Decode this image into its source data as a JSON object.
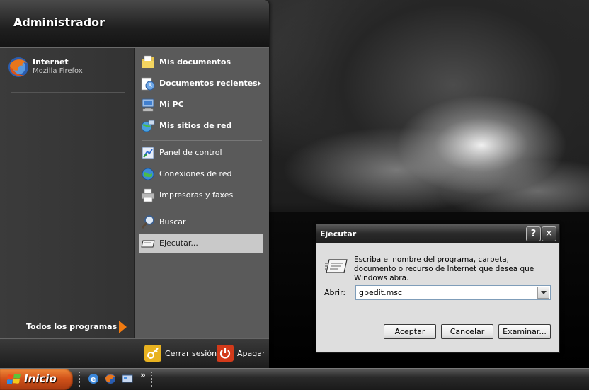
{
  "start_menu": {
    "user_name": "Administrador",
    "pinned": [
      {
        "title": "Internet",
        "subtitle": "Mozilla Firefox"
      }
    ],
    "all_programs_label": "Todos los programas",
    "right_items": {
      "mis_documentos": "Mis documentos",
      "documentos_recientes": "Documentos recientes",
      "mi_pc": "Mi PC",
      "mis_sitios_de_red": "Mis sitios de red",
      "panel_de_control": "Panel de control",
      "conexiones_de_red": "Conexiones de red",
      "impresoras_y_faxes": "Impresoras y faxes",
      "buscar": "Buscar",
      "ejecutar": "Ejecutar..."
    },
    "footer": {
      "log_off_label": "Cerrar sesión",
      "shutdown_label": "Apagar"
    }
  },
  "taskbar": {
    "start_label": "Inicio",
    "quick_launch_more": "»",
    "quick_launch": [
      "internet-explorer-icon",
      "firefox-icon",
      "show-desktop-icon"
    ]
  },
  "run_dialog": {
    "title": "Ejecutar",
    "help_glyph": "?",
    "close_glyph": "✕",
    "description": "Escriba el nombre del programa, carpeta, documento o recurso de Internet que desea que Windows abra.",
    "open_label": "Abrir:",
    "open_value": "gpedit.msc",
    "ok_label": "Aceptar",
    "cancel_label": "Cancelar",
    "browse_label": "Examinar..."
  },
  "colors": {
    "start_button": "#d2531a",
    "all_programs_arrow": "#f07a10",
    "menu_hover": "#c9c9c9",
    "shutdown_red": "#d23a1a",
    "logoff_yellow": "#e8b220"
  }
}
